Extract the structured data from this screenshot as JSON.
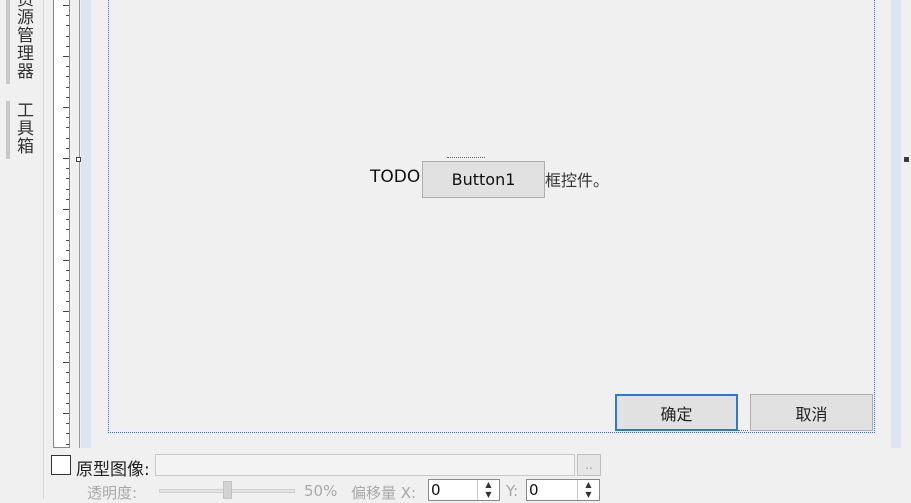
{
  "dock": {
    "tab_resources": "资源管理器",
    "tab_toolbox": "工具箱"
  },
  "form": {
    "todo_label": "TODO",
    "todo_tail": "框控件。",
    "button1_label": "Button1",
    "ok_label": "确定",
    "cancel_label": "取消"
  },
  "prototype": {
    "checkbox_label": "原型图像:",
    "path_value": "",
    "browse_label": "..",
    "opacity_label": "透明度:",
    "opacity_value": 0.5,
    "opacity_text": "50%",
    "offset_x_label": "偏移量 X:",
    "offset_x_value": "0",
    "offset_y_label": "Y:",
    "offset_y_value": "0"
  },
  "colors": {
    "focus_border": "#2a7ad4",
    "form_outline": "#5566aa"
  }
}
